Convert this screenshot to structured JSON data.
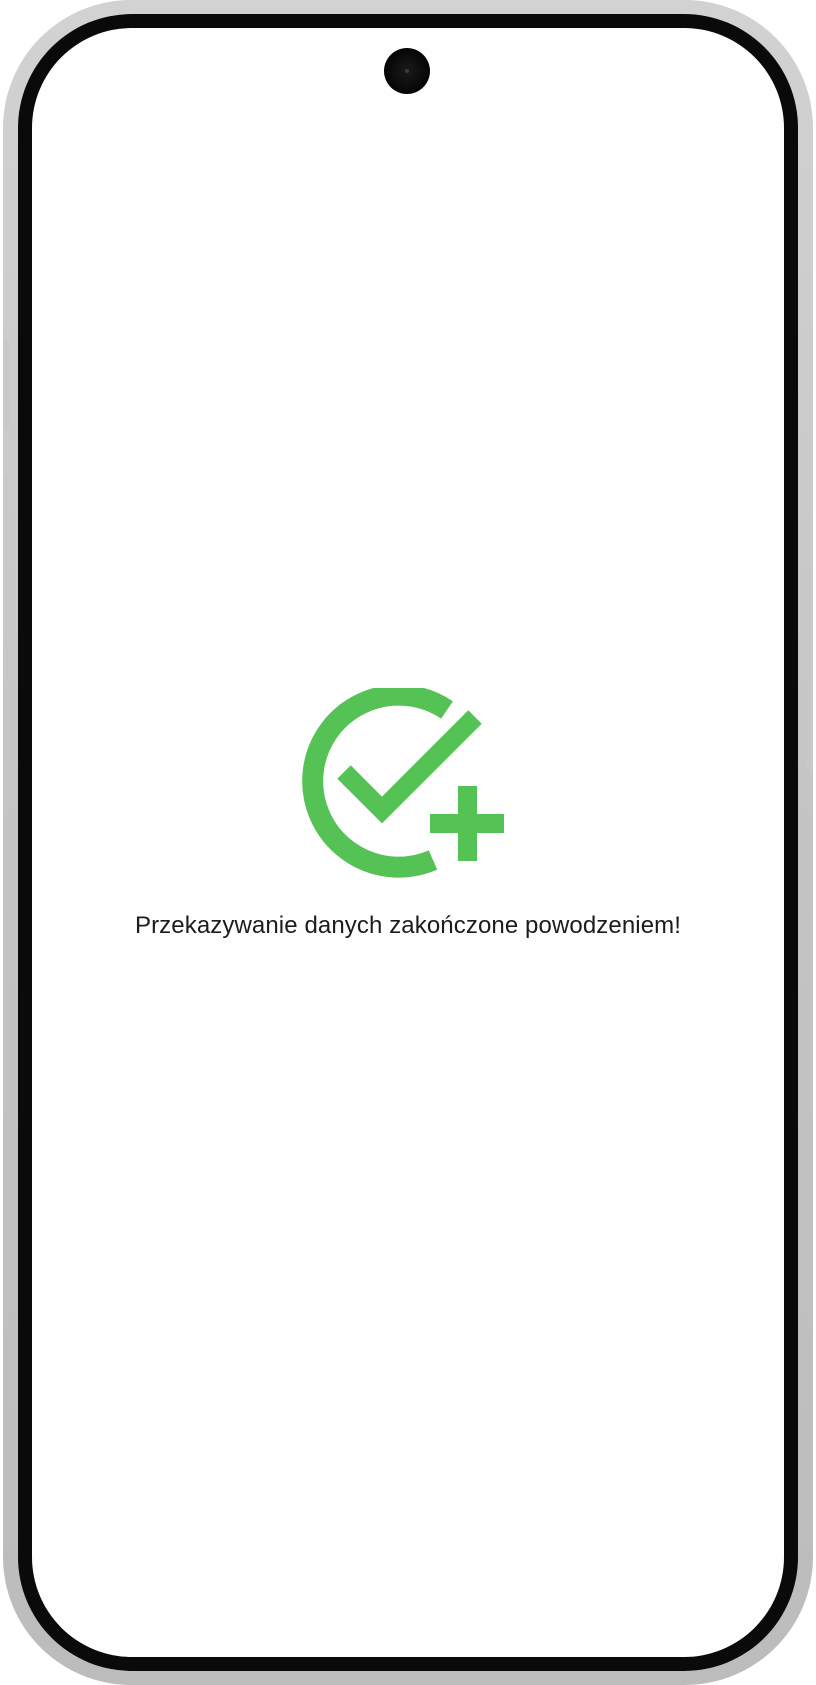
{
  "screen": {
    "message": "Przekazywanie danych zakończone powodzeniem!"
  },
  "icons": {
    "logo": "check-plus-circle-icon",
    "camera": "front-camera"
  },
  "colors": {
    "accent": "#55c255",
    "text": "#1c1c1c",
    "background": "#fefefe",
    "frame": "#c8c8c8",
    "bezel": "#0a0a0a"
  }
}
